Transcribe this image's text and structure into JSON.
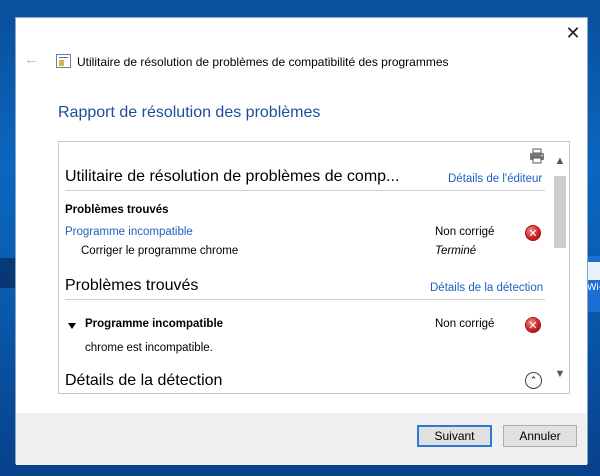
{
  "desktop": {
    "icon_label": "Wi-\nra"
  },
  "window": {
    "title": "Utilitaire de résolution de problèmes de compatibilité des programmes",
    "back_glyph": "←",
    "close_glyph": "✕"
  },
  "page": {
    "title": "Rapport de résolution des problèmes"
  },
  "report": {
    "section1": {
      "heading": "Utilitaire de résolution de problèmes de comp...",
      "link": "Détails de l'éditeur",
      "subheading": "Problèmes trouvés",
      "item_link": "Programme incompatible",
      "item_status": "Non corrigé",
      "sub_item": "Corriger le programme chrome",
      "sub_item_status": "Terminé"
    },
    "section2": {
      "heading": "Problèmes trouvés",
      "link": "Détails de la détection",
      "item": "Programme incompatible",
      "item_status": "Non corrigé",
      "detail": "chrome est incompatible."
    },
    "section3": {
      "heading": "Détails de la détection",
      "collapse_glyph": "⌃"
    },
    "error_glyph": "✕",
    "scroll_up_glyph": "▲",
    "scroll_down_glyph": "▼"
  },
  "footer": {
    "next_label": "Suivant",
    "cancel_label": "Annuler"
  },
  "colors": {
    "accent_link": "#1f5fbf",
    "title_blue": "#1c4e9a",
    "error_red": "#cc1f1f",
    "primary_border": "#2d7ad6"
  }
}
